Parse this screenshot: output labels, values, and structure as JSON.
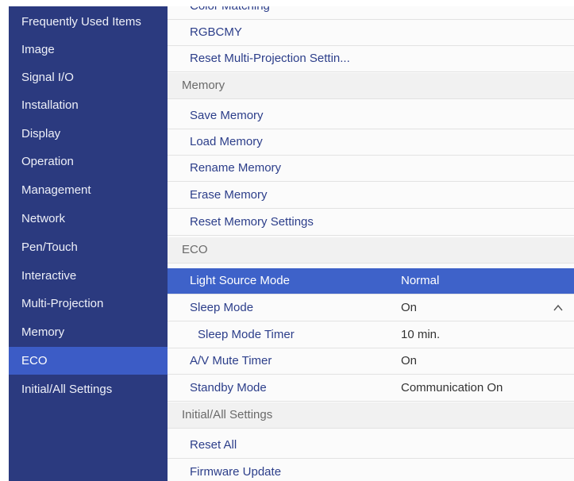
{
  "sidebar": {
    "items": [
      {
        "label": "Frequently Used Items"
      },
      {
        "label": "Image"
      },
      {
        "label": "Signal I/O"
      },
      {
        "label": "Installation"
      },
      {
        "label": "Display"
      },
      {
        "label": "Operation"
      },
      {
        "label": "Management"
      },
      {
        "label": "Network"
      },
      {
        "label": "Pen/Touch"
      },
      {
        "label": "Interactive"
      },
      {
        "label": "Multi-Projection"
      },
      {
        "label": "Memory"
      },
      {
        "label": "ECO"
      },
      {
        "label": "Initial/All Settings"
      }
    ],
    "active": "ECO"
  },
  "main": {
    "multi_projection": {
      "cut_off_item": "Color Matching",
      "rgbcmy": "RGBCMY",
      "reset": "Reset Multi-Projection Settin..."
    },
    "memory": {
      "header": "Memory",
      "save": "Save Memory",
      "load": "Load Memory",
      "rename": "Rename Memory",
      "erase": "Erase Memory",
      "reset": "Reset Memory Settings"
    },
    "eco": {
      "header": "ECO",
      "light_source_mode": {
        "label": "Light Source Mode",
        "value": "Normal"
      },
      "sleep_mode": {
        "label": "Sleep Mode",
        "value": "On"
      },
      "sleep_mode_timer": {
        "label": "Sleep Mode Timer",
        "value": "10 min."
      },
      "av_mute_timer": {
        "label": "A/V Mute Timer",
        "value": "On"
      },
      "standby_mode": {
        "label": "Standby Mode",
        "value": "Communication On"
      }
    },
    "initial": {
      "header": "Initial/All Settings",
      "reset_all": "Reset All",
      "firmware_update": "Firmware Update"
    }
  },
  "colors": {
    "sidebar_bg": "#2b3a7f",
    "sidebar_active": "#3c5cc6",
    "selected_row": "#3e62c9",
    "item_text": "#2c3e8a"
  },
  "icons": {
    "sleep_mode_toggle": "chevron-up-icon"
  }
}
